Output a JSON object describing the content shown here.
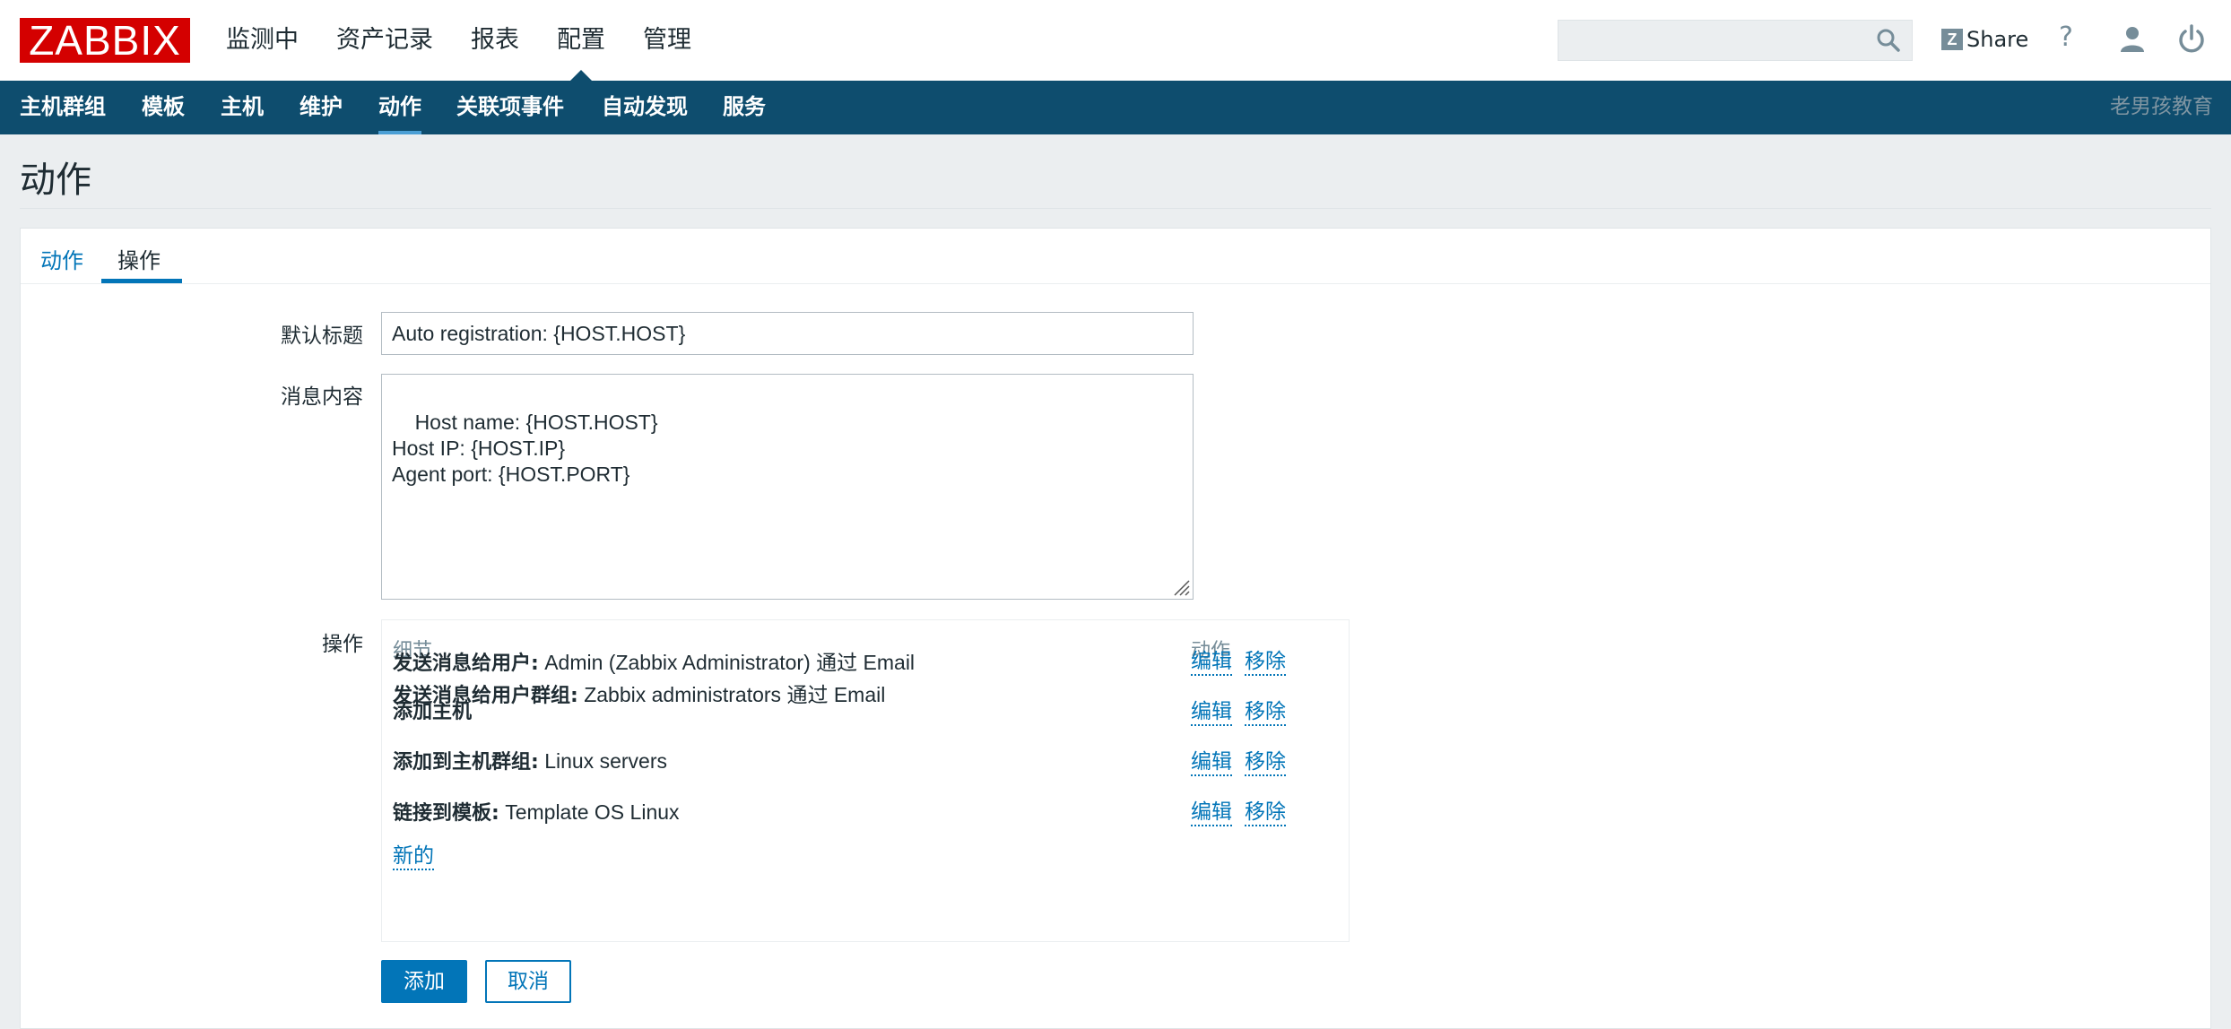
{
  "header": {
    "logo_text": "ZABBIX",
    "menu": [
      "监测中",
      "资产记录",
      "报表",
      "配置",
      "管理"
    ],
    "active_menu": "配置",
    "search": {
      "value": "",
      "placeholder": ""
    },
    "share_icon_letter": "Z",
    "share_label": "Share",
    "help_label": "?"
  },
  "subnav": {
    "items": [
      "主机群组",
      "模板",
      "主机",
      "维护",
      "动作",
      "关联项事件",
      "自动发现",
      "服务"
    ],
    "active": "动作",
    "brand": "老男孩教育"
  },
  "page": {
    "title": "动作"
  },
  "tabs": [
    "动作",
    "操作"
  ],
  "active_tab": "操作",
  "form": {
    "default_subject_label": "默认标题",
    "default_subject_value": "Auto registration: {HOST.HOST}",
    "message_label": "消息内容",
    "message_value": "Host name: {HOST.HOST}\nHost IP: {HOST.IP}\nAgent port: {HOST.PORT}",
    "operations_label": "操作"
  },
  "operations": {
    "col_details": "细节",
    "col_action": "动作",
    "rows": [
      {
        "lines": [
          {
            "bold": "发送消息给用户:",
            "text": " Admin (Zabbix Administrator) 通过 Email"
          },
          {
            "bold": "发送消息给用户群组:",
            "text": " Zabbix administrators 通过 Email"
          }
        ]
      },
      {
        "lines": [
          {
            "bold": "添加主机",
            "text": ""
          }
        ]
      },
      {
        "lines": [
          {
            "bold": "添加到主机群组:",
            "text": " Linux servers"
          }
        ]
      },
      {
        "lines": [
          {
            "bold": "链接到模板:",
            "text": " Template OS Linux"
          }
        ]
      }
    ],
    "edit_label": "编辑",
    "remove_label": "移除",
    "new_label": "新的"
  },
  "buttons": {
    "add": "添加",
    "cancel": "取消"
  },
  "colors": {
    "brand_red": "#d40000",
    "nav_blue": "#0e4d6e",
    "link_blue": "#0275b8",
    "page_bg": "#ebeef0"
  },
  "icons": [
    "search-icon",
    "share-icon",
    "help-icon",
    "user-icon",
    "power-icon",
    "resize-grip-icon"
  ]
}
